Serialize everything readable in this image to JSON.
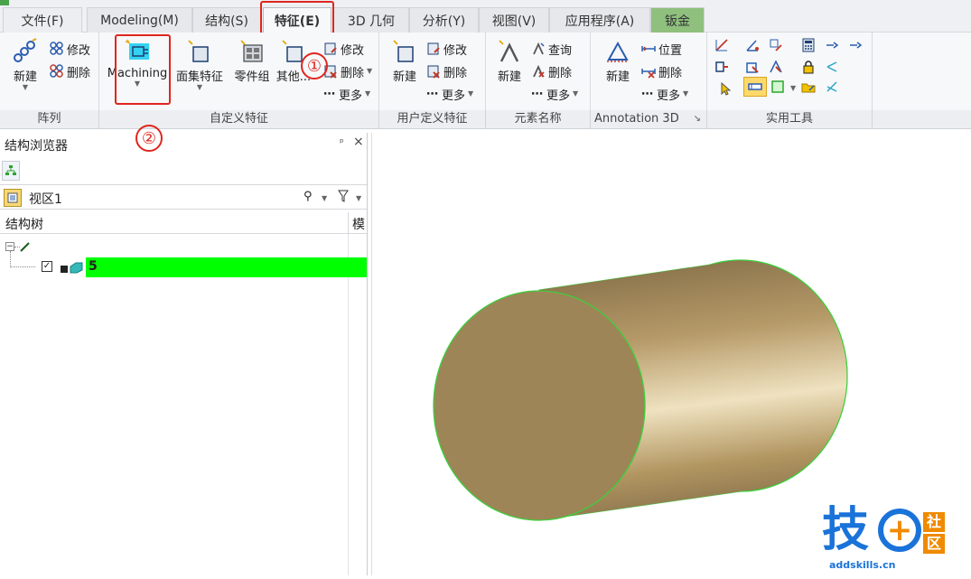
{
  "tabs": {
    "file": "文件(F)",
    "modeling": "Modeling(M)",
    "structure": "结构(S)",
    "feature": "特征(E)",
    "geometry3d": "3D 几何",
    "analysis": "分析(Y)",
    "view": "视图(V)",
    "apps": "应用程序(A)",
    "sheetmetal": "钣金"
  },
  "ribbon": {
    "array": {
      "new": "新建",
      "modify": "修改",
      "delete": "删除",
      "group": "阵列"
    },
    "custom": {
      "machining": "Machining",
      "face_set": "面集特征",
      "part_group": "零件组",
      "other": "其他...",
      "modify": "修改",
      "delete": "删除",
      "more": "更多",
      "group": "自定义特征"
    },
    "user_defined": {
      "new": "新建",
      "modify": "修改",
      "delete": "删除",
      "more": "更多",
      "group": "用户定义特征"
    },
    "element_name": {
      "new": "新建",
      "query": "查询",
      "delete": "删除",
      "more": "更多",
      "group": "元素名称"
    },
    "annotation": {
      "new": "新建",
      "position": "位置",
      "delete": "删除",
      "more": "更多",
      "group": "Annotation 3D"
    },
    "tools": {
      "group": "实用工具"
    }
  },
  "panel": {
    "title": "结构浏览器",
    "pin": "ᵖ",
    "close": "×",
    "view_name": "视区1",
    "col_tree": "结构树",
    "col_right": "模",
    "item_label": "5"
  },
  "annotations": {
    "one": "①",
    "two": "②"
  },
  "watermark": {
    "big": "技",
    "plus": "+",
    "she": "社",
    "qu": "区",
    "url": "addskills.cn"
  },
  "colors": {
    "highlight_red": "#e0261e",
    "selected_row": "#00ff00",
    "cylinder": "#b89b68",
    "tab_green": "#8fc07d"
  }
}
